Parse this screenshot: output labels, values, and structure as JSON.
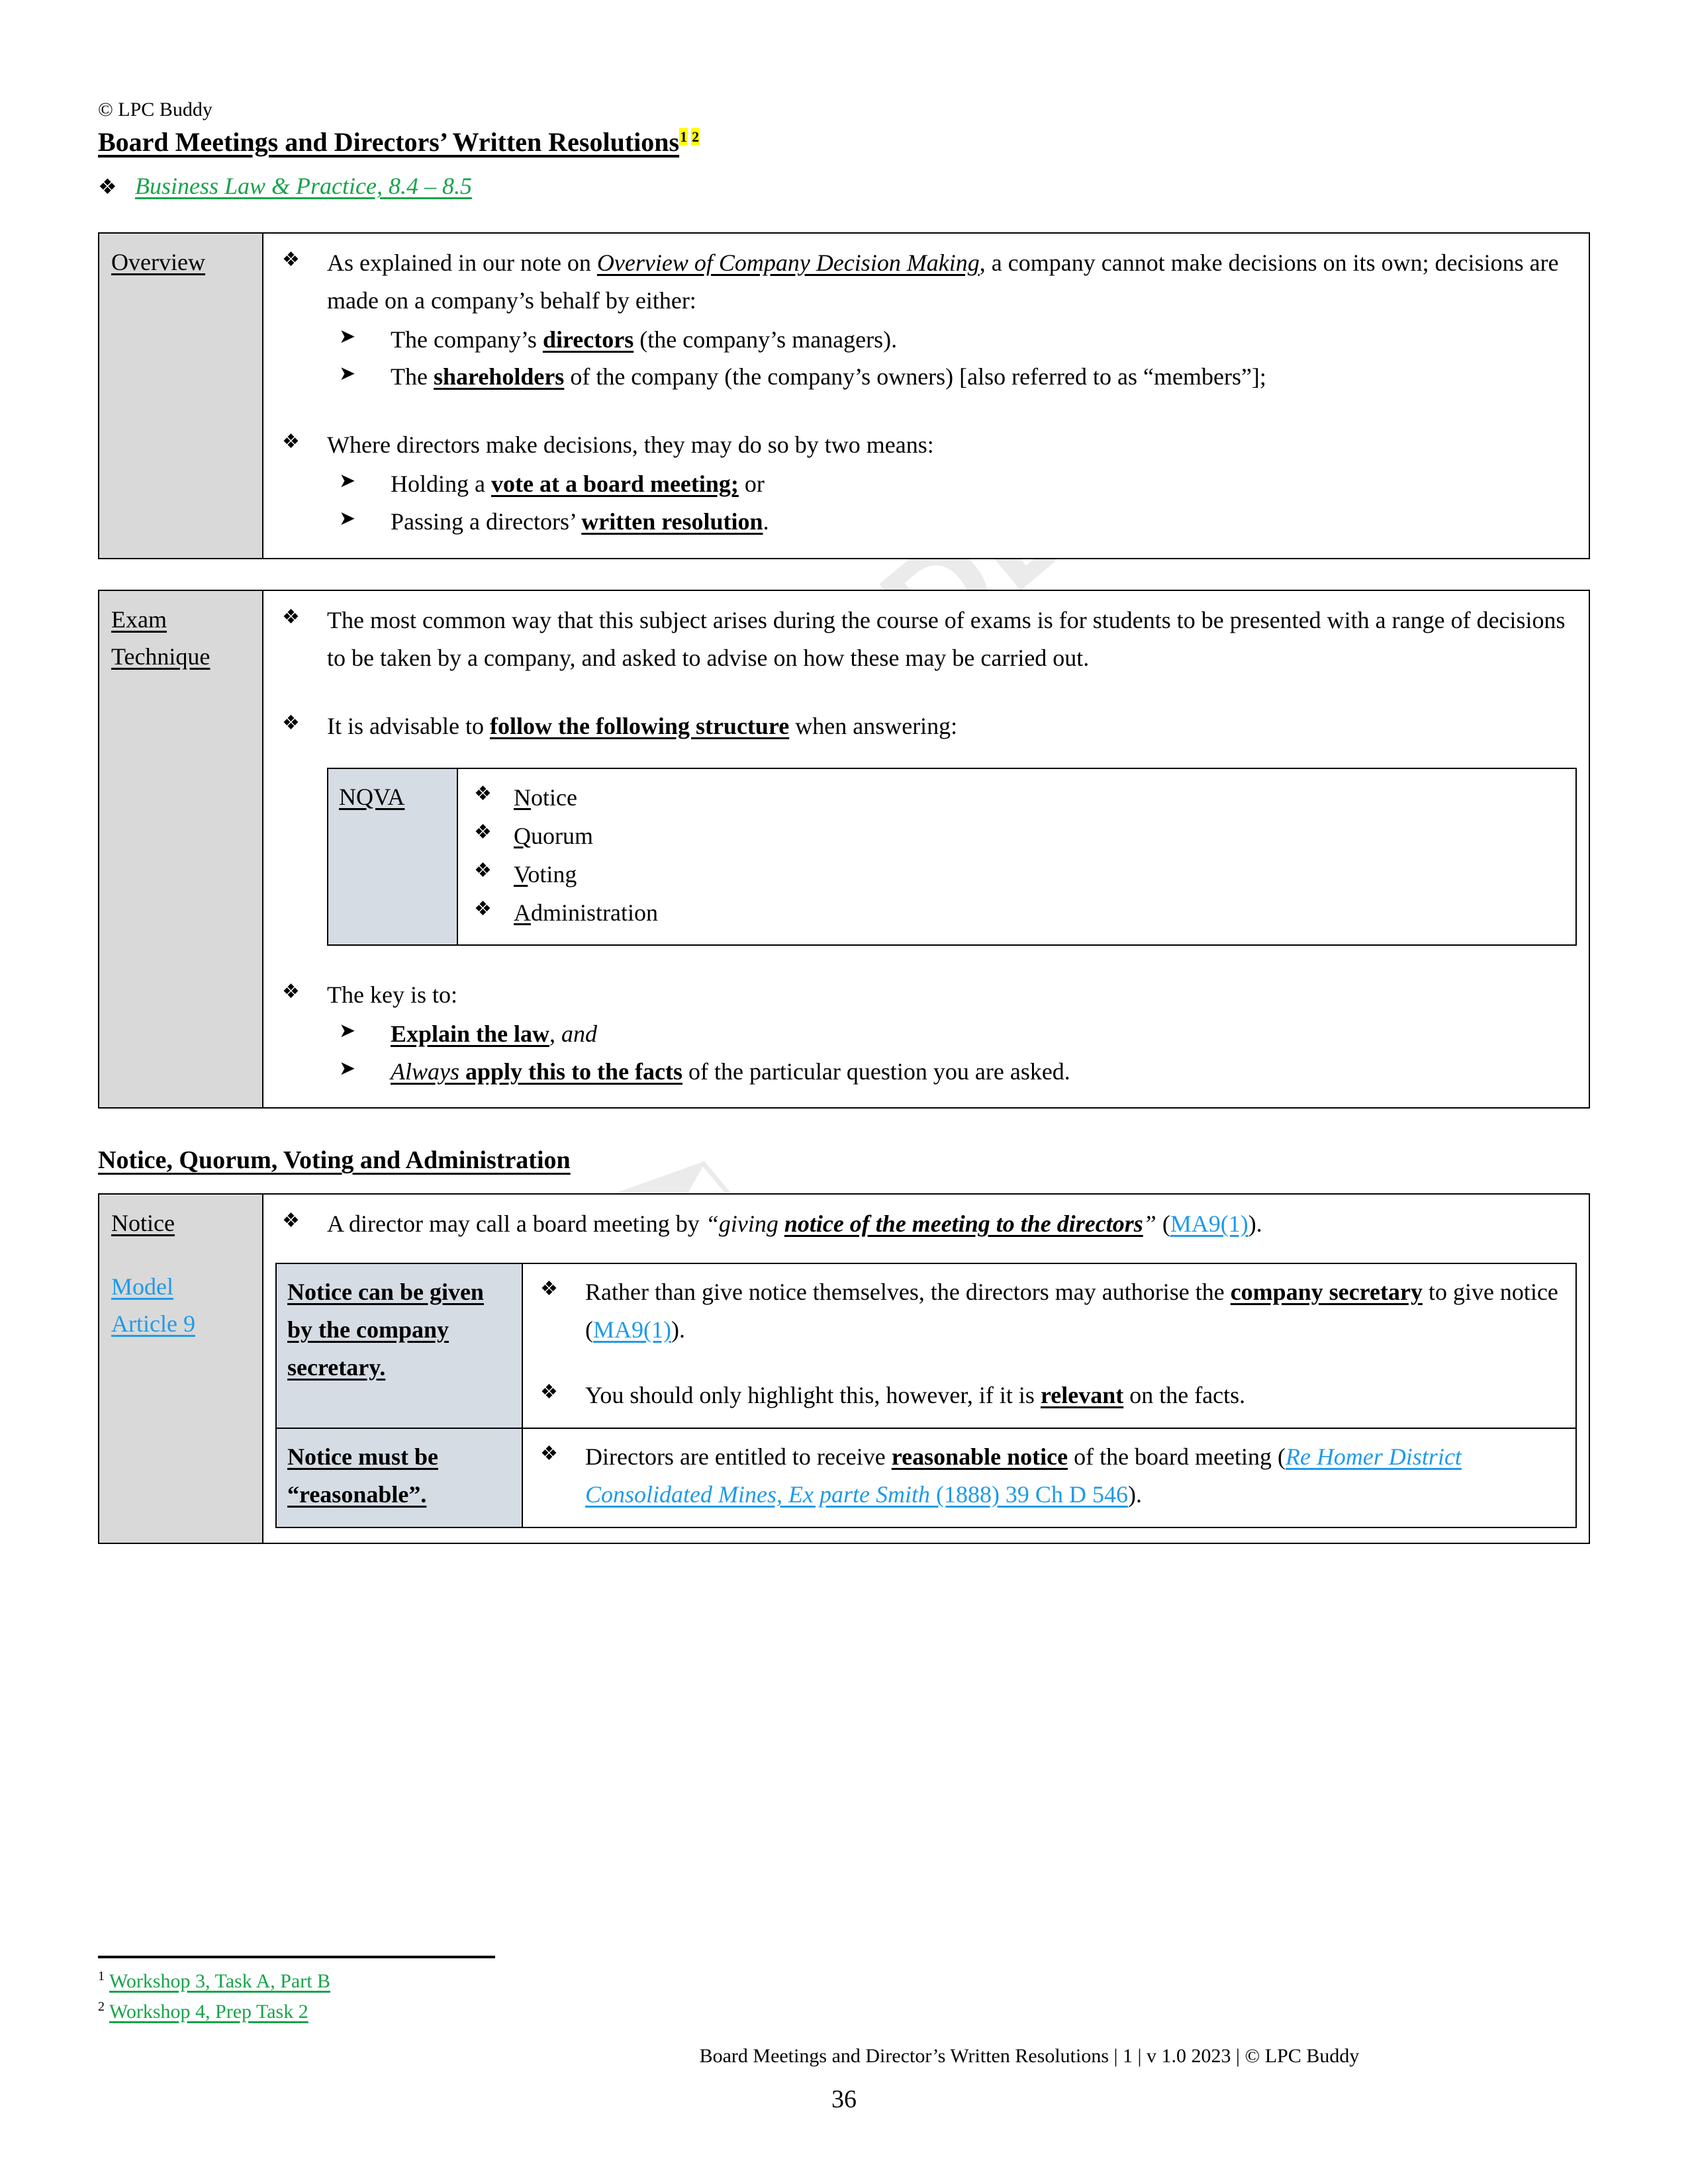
{
  "header": {
    "copyright": "© LPC Buddy",
    "title": "Board Meetings and Directors’ Written Resolutions",
    "footnote_ref_1": "1",
    "footnote_ref_2": "2",
    "source_reference": "Business Law & Practice, 8.4 – 8.5"
  },
  "colors": {
    "green_link": "#16a34a",
    "blue_link": "#1f9ae8",
    "highlight": "#ffff00",
    "label_gray": "#d9d9d9",
    "label_blue_gray": "#d6dce4"
  },
  "overview": {
    "label": "Overview",
    "b1_pre": "As explained in our note on ",
    "b1_link": "Overview of Company Decision Making",
    "b1_post": ", a company cannot make decisions on its own; decisions are made on a company’s behalf by either:",
    "b1_sub1_pre": "The company’s ",
    "b1_sub1_bold": "directors",
    "b1_sub1_post": " (the company’s managers).",
    "b1_sub2_pre": "The ",
    "b1_sub2_bold": "shareholders",
    "b1_sub2_post": " of the company (the company’s owners) [also referred to as “members”];",
    "b2": "Where directors make decisions, they may do so by two means:",
    "b2_sub1_pre": "Holding a ",
    "b2_sub1_bold": "vote at a board meeting;",
    "b2_sub1_post": " or",
    "b2_sub2_pre": "Passing a directors’ ",
    "b2_sub2_bold": "written resolution",
    "b2_sub2_post": "."
  },
  "exam_technique": {
    "label_line1": "Exam",
    "label_line2": "Technique",
    "b1": "The most common way that this subject arises during the course of exams is for students to be presented with a range of decisions to be taken by a company, and asked to advise on how these may be carried out.",
    "b2_pre": "It is advisable to ",
    "b2_bold": "follow the following structure",
    "b2_post": " when answering:",
    "nqva": {
      "label": "NQVA",
      "items": [
        {
          "initial": "N",
          "rest": "otice"
        },
        {
          "initial": "Q",
          "rest": "uorum"
        },
        {
          "initial": "V",
          "rest": "oting"
        },
        {
          "initial": "A",
          "rest": "dministration"
        }
      ]
    },
    "b3": "The key is to:",
    "b3_sub1_bold": "Explain the law",
    "b3_sub1_mid": ", ",
    "b3_sub1_italic": "and",
    "b3_sub2_italic": "Always",
    "b3_sub2_bold": " apply this to the facts",
    "b3_sub2_post": " of the particular question you are asked."
  },
  "section_heading": "Notice, Quorum, Voting and Administration",
  "notice": {
    "label": "Notice",
    "label_link_line1": "Model",
    "label_link_line2": "Article 9",
    "b1_pre": "A director may call a board meeting by ",
    "b1_quote_open": "“giving ",
    "b1_quote_bold": "notice of the meeting to the directors",
    "b1_quote_close": "”",
    "b1_cite_open": " (",
    "b1_cite_link": "MA9(1)",
    "b1_cite_close": ").",
    "rows": [
      {
        "label": "Notice can be given by the company secretary.",
        "bullets": [
          {
            "pre": "Rather than give notice themselves, the directors may authorise the ",
            "bold": "company secretary",
            "mid": " to give notice (",
            "link": "MA9(1)",
            "post": ")."
          },
          {
            "pre": "You should only highlight this, however, if it is ",
            "bold": "relevant",
            "mid": " on the facts.",
            "link": "",
            "post": ""
          }
        ]
      },
      {
        "label": "Notice must be “reasonable”.",
        "bullets": [
          {
            "pre": "Directors are entitled to receive ",
            "bold": "reasonable notice",
            "mid": " of the board meeting (",
            "link_italic": "Re Homer District Consolidated Mines, Ex parte Smith",
            "link_plain": " (1888) 39 Ch D 546",
            "post": ")."
          }
        ]
      }
    ]
  },
  "footnotes": [
    {
      "number": "1",
      "text": "Workshop 3, Task A, Part B"
    },
    {
      "number": "2",
      "text": "Workshop 4, Prep Task 2"
    }
  ],
  "footer": {
    "line": "Board Meetings and Director’s Written Resolutions | 1 | v 1.0 2023 | © LPC Buddy",
    "page_number": "36"
  },
  "watermark": {
    "text": "LPC BUDDY"
  }
}
